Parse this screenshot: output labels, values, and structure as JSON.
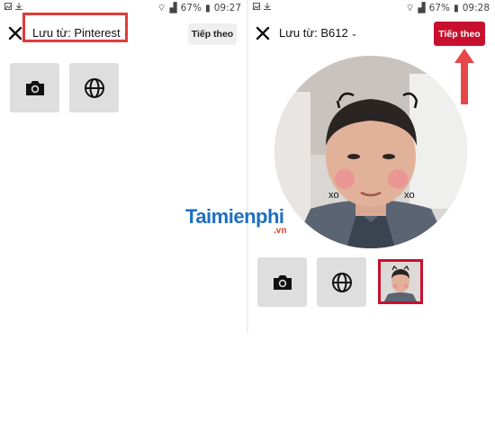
{
  "left_screen": {
    "status": {
      "battery": "67%",
      "time": "09:27"
    },
    "header": {
      "save_from_label": "Lưu từ: Pinterest",
      "next_label": "Tiếp theo"
    },
    "tiles": [
      {
        "icon": "camera-icon"
      },
      {
        "icon": "globe-icon"
      }
    ]
  },
  "right_screen": {
    "status": {
      "battery": "67%",
      "time": "09:28"
    },
    "header": {
      "save_from_label": "Lưu từ: B612",
      "next_label": "Tiếp theo"
    },
    "tiles": [
      {
        "icon": "camera-icon"
      },
      {
        "icon": "globe-icon"
      },
      {
        "icon": "selected-photo-thumbnail"
      }
    ],
    "photo_stickers": [
      "xo",
      "xo"
    ]
  },
  "watermark": {
    "main": "aimienphi",
    "initial": "T",
    "sub": ".vn"
  },
  "colors": {
    "accent_red": "#c8102e",
    "highlight": "#e03b3b",
    "tile_bg": "#dedede"
  }
}
